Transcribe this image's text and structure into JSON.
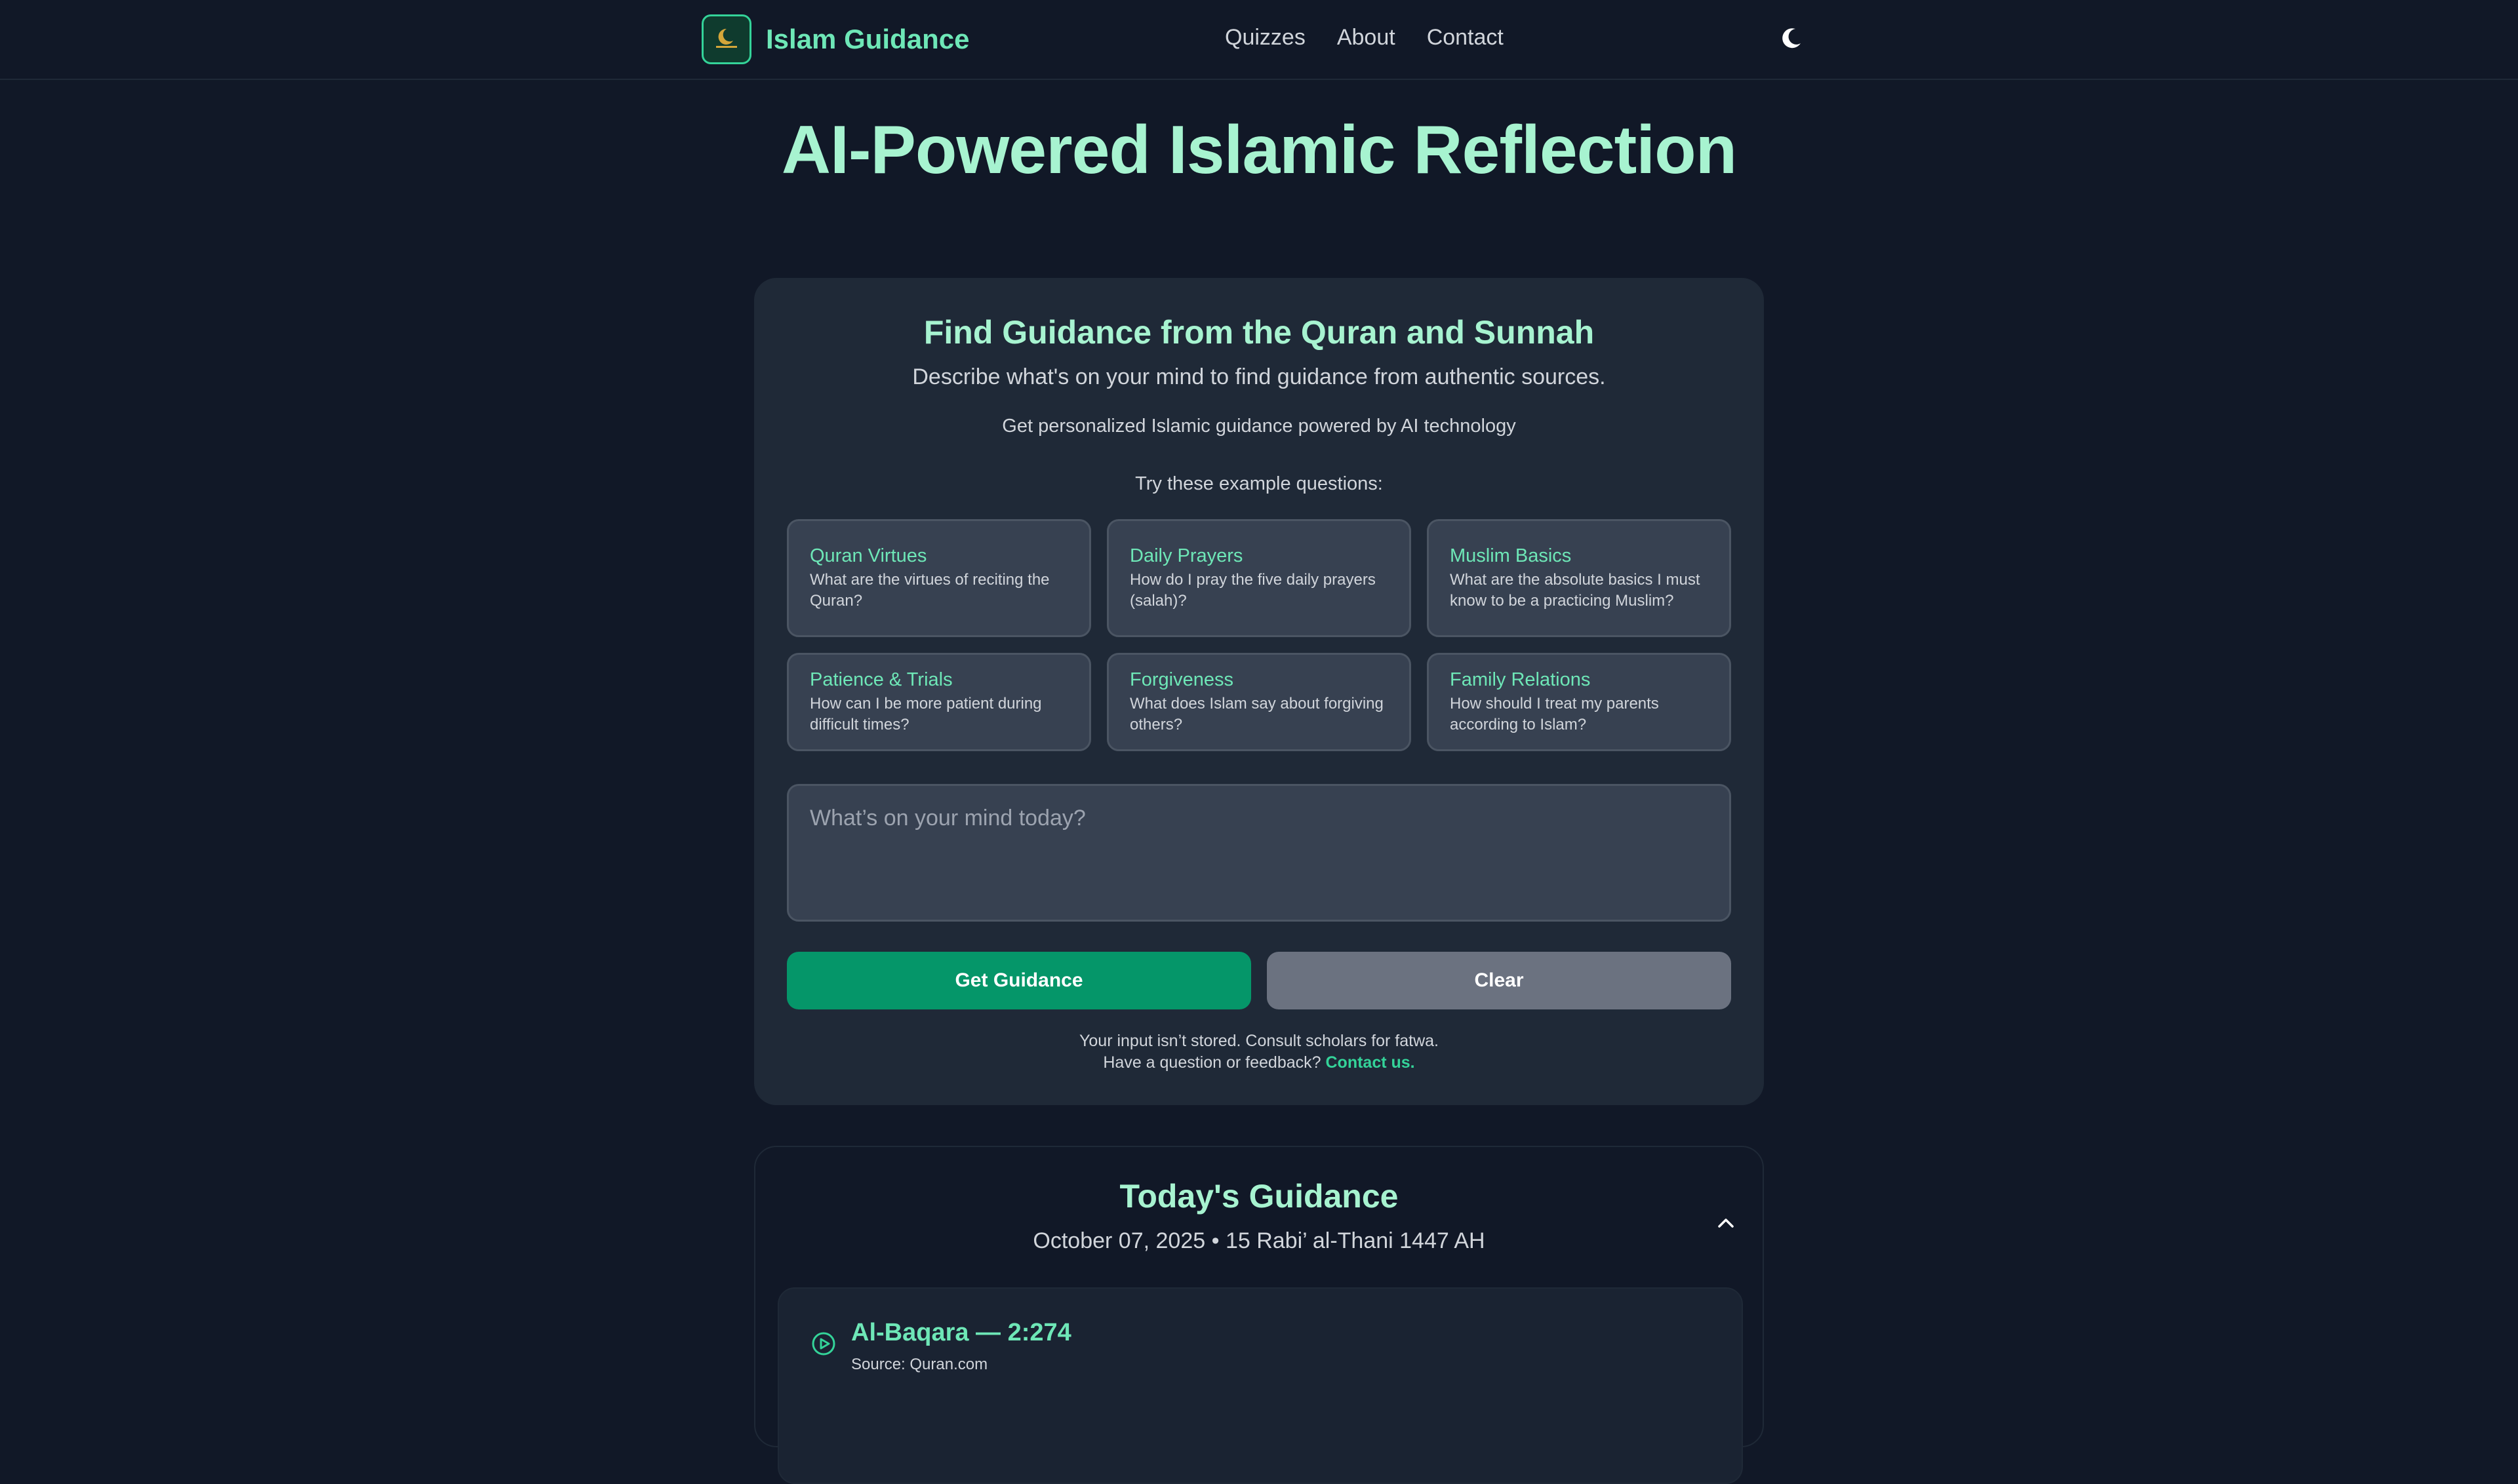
{
  "nav": {
    "brand": "Islam Guidance",
    "links": [
      "Quizzes",
      "About",
      "Contact"
    ],
    "theme_toggle_icon": "moon-icon"
  },
  "hero": {
    "title": "AI-Powered Islamic Reflection"
  },
  "card": {
    "title": "Find Guidance from the Quran and Sunnah",
    "subtitle": "Describe what's on your mind to find guidance from authentic sources.",
    "subtitle2": "Get personalized Islamic guidance powered by AI technology",
    "examples_heading": "Try these example questions:",
    "examples": [
      {
        "title": "Quran Virtues",
        "desc": "What are the virtues of reciting the Quran?"
      },
      {
        "title": "Daily Prayers",
        "desc": "How do I pray the five daily prayers (salah)?"
      },
      {
        "title": "Muslim Basics",
        "desc": "What are the absolute basics I must know to be a practicing Muslim?"
      },
      {
        "title": "Patience & Trials",
        "desc": "How can I be more patient during difficult times?"
      },
      {
        "title": "Forgiveness",
        "desc": "What does Islam say about forgiving others?"
      },
      {
        "title": "Family Relations",
        "desc": "How should I treat my parents according to Islam?"
      }
    ],
    "input": {
      "placeholder": "What’s on your mind today?",
      "value": ""
    },
    "primary_button": "Get Guidance",
    "secondary_button": "Clear",
    "footnote_line1": "Your input isn’t stored. Consult scholars for fatwa.",
    "footnote_line2": "Have a question or feedback?",
    "footnote_link": "Contact us."
  },
  "today": {
    "title": "Today's Guidance",
    "date": "October 07, 2025 • 15 Rabi’ al-Thani 1447 AH",
    "verse": {
      "reference": "Al-Baqara — 2:274",
      "source": "Source: Quran.com"
    }
  },
  "colors": {
    "accent": "#6ee7b7",
    "accent_light": "#a7f3d0",
    "primary_button": "#059669",
    "secondary_button": "#6b7280",
    "background": "#111827",
    "card": "#1f2937"
  }
}
